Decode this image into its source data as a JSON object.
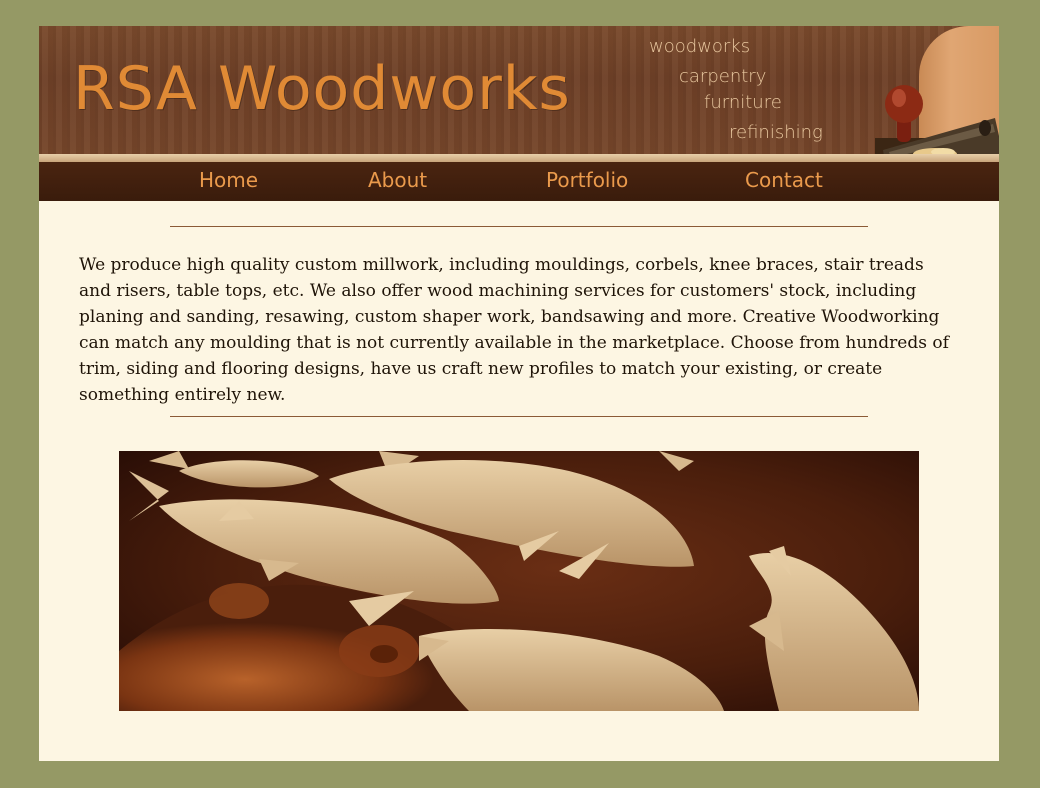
{
  "header": {
    "logo": "RSA Woodworks",
    "taglines": [
      "woodworks",
      "carpentry",
      "furniture",
      "refinishing"
    ]
  },
  "nav": {
    "items": [
      {
        "label": "Home"
      },
      {
        "label": "About"
      },
      {
        "label": "Portfolio"
      },
      {
        "label": "Contact"
      }
    ]
  },
  "main": {
    "intro": "We produce high quality custom millwork, including mouldings, corbels, knee braces, stair treads and risers, table tops, etc. We also offer wood machining services for customers' stock, including planing and sanding, resawing, custom shaper work, bandsawing and more. Creative Woodworking can match any moulding that is not currently available in the marketplace. Choose from hundreds of trim, siding and flooring designs, have us craft new profiles to match your existing, or create something entirely new."
  },
  "colors": {
    "page_background": "#959965",
    "content_background": "#fdf6e3",
    "logo": "#e08a35",
    "nav_text": "#ea9a4c",
    "nav_background": "#3f1e0d"
  },
  "icons": {
    "header_decoration": "hand-plane-icon"
  }
}
